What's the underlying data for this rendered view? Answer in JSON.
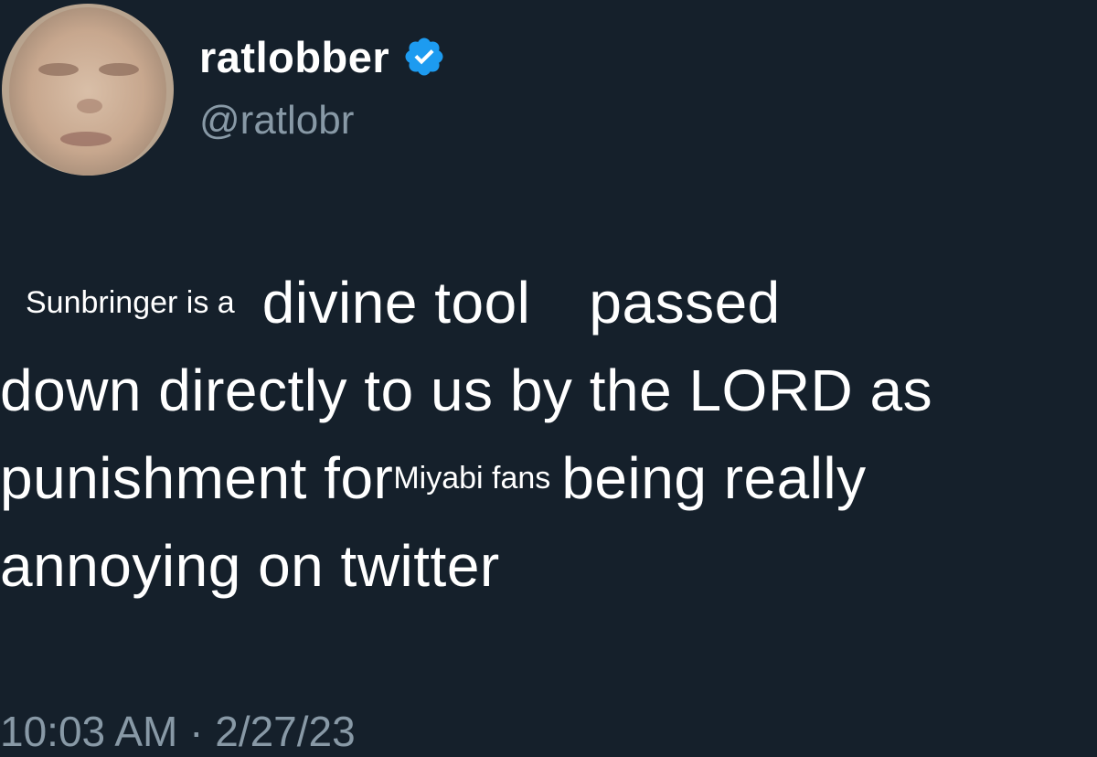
{
  "tweet": {
    "display_name": "ratlobber",
    "handle": "@ratlobr",
    "verified_icon": "verified-badge-icon",
    "text": {
      "line1_small": "Sunbringer is a",
      "line1_big_a": "divine tool",
      "line1_big_b": "passed",
      "line2": "down directly to us by the LORD as",
      "line3_big_a": "punishment for",
      "line3_small": "Miyabi fans",
      "line3_big_b": "being really",
      "line4": "annoying on twitter"
    },
    "timestamp": "10:03 AM · 2/27/23"
  },
  "colors": {
    "background": "#15202b",
    "text": "#ffffff",
    "secondary": "#8899a6",
    "verified": "#1d9bf0"
  }
}
